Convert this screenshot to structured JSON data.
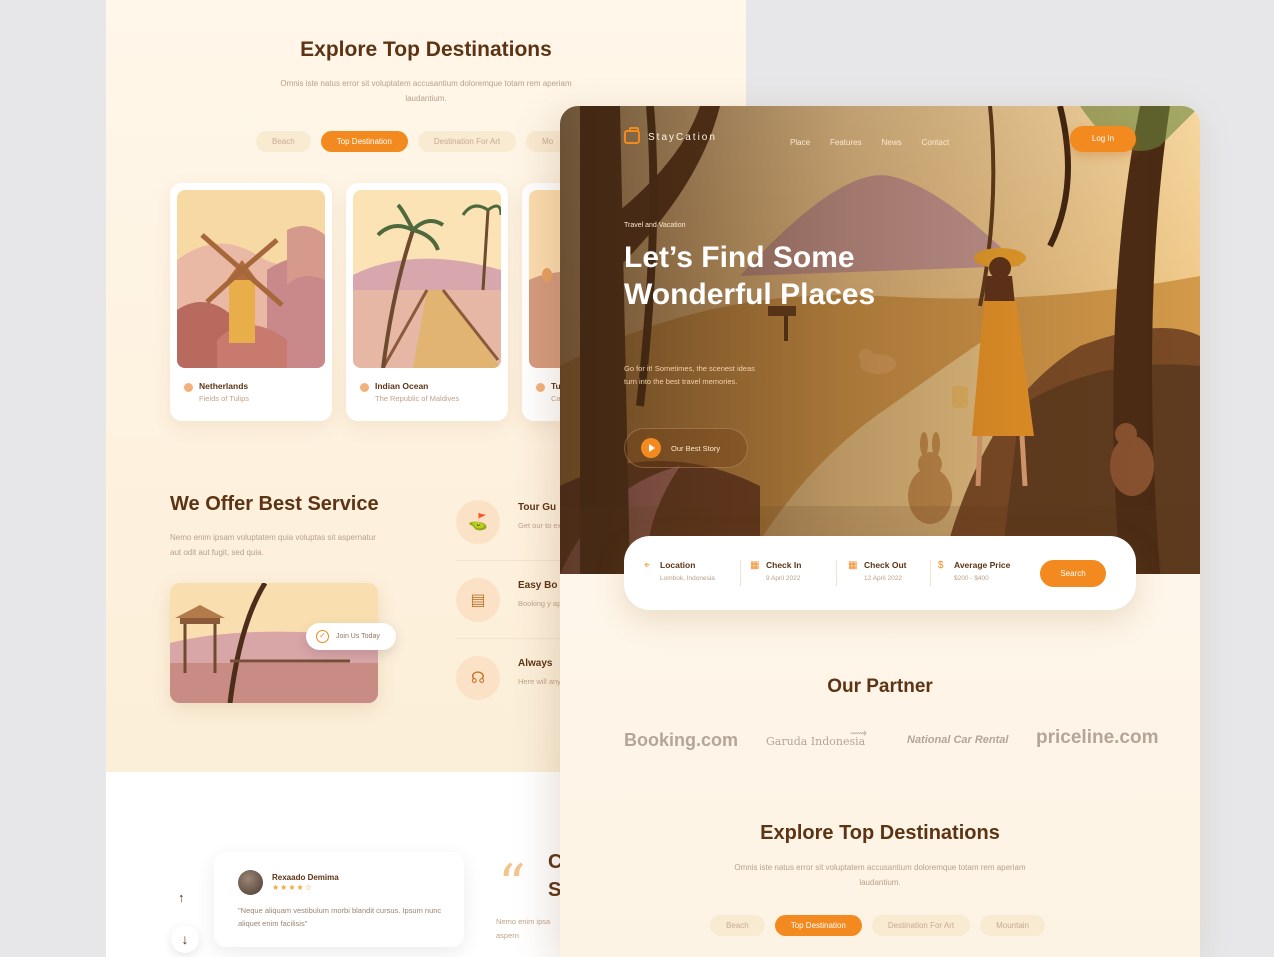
{
  "back": {
    "explore_title": "Explore Top Destinations",
    "explore_sub": "Omnis iste natus error sit voluptatem accusantium doloremque totam rem aperiam laudantium.",
    "tabs": [
      "Beach",
      "Top Destination",
      "Destination For Art",
      "Mo"
    ],
    "cards": [
      {
        "name": "Netherlands",
        "desc": "Fields of Tulips"
      },
      {
        "name": "Indian Ocean",
        "desc": "The Republic of Maldives"
      },
      {
        "name": "Tu",
        "desc": "Ca"
      }
    ],
    "service_title": "We Offer Best Service",
    "service_sub": "Nemo enim ipsam voluptatem quia voluptas sit aspernatur aut odit aut fugit, sed quia.",
    "join_label": "Join Us Today",
    "services": [
      {
        "name": "Tour Gu",
        "desc": "Get our to experienc",
        "icon": "map-icon"
      },
      {
        "name": "Easy Bo",
        "desc": "Booking y applicati",
        "icon": "ticket-icon"
      },
      {
        "name": "Always",
        "desc": "Here will any probl",
        "icon": "headset-icon"
      }
    ],
    "review": {
      "name": "Rexaado Demima",
      "stars": "★★★★☆",
      "text": "\"Neque aliquam vestibulum morbi blandit cursus. Ipsum nunc aliquet enim facilisis\""
    },
    "testimonial_partial_heading": "C\nS",
    "testimonial_partial_text": "Nemo enim ipsa aspern",
    "arrow_up": "↑",
    "arrow_down": "↓"
  },
  "front": {
    "brand": "StayCation",
    "nav": [
      "Place",
      "Features",
      "News",
      "Contact"
    ],
    "login": "Log In",
    "kicker": "Travel and Vacation",
    "hero_title": "Let’s Find Some Wonderful Places",
    "hero_sub": "Go for it! Sometimes, the scenest ideas turn into the best travel memories.",
    "story_btn": "Our Best Story",
    "search": {
      "location_label": "Location",
      "location_value": "Lombok, Indonesia",
      "checkin_label": "Check In",
      "checkin_value": "9 April 2022",
      "checkout_label": "Check Out",
      "checkout_value": "12 April 2022",
      "price_label": "Average Price",
      "price_value": "$200 - $400",
      "button": "Search"
    },
    "partner_title": "Our Partner",
    "partners": [
      "Booking.com",
      "Garuda Indonesia",
      "National Car Rental",
      "priceline.com"
    ],
    "explore_title": "Explore Top Destinations",
    "explore_sub": "Omnis iste natus error sit voluptatem accusantium doloremque totam rem aperiam laudantium.",
    "tabs": [
      "Beach",
      "Top Destination",
      "Destination For Art",
      "Mountain"
    ]
  },
  "colors": {
    "accent": "#f28a1f",
    "heading": "#5c3414",
    "muted": "#b8a08a"
  }
}
